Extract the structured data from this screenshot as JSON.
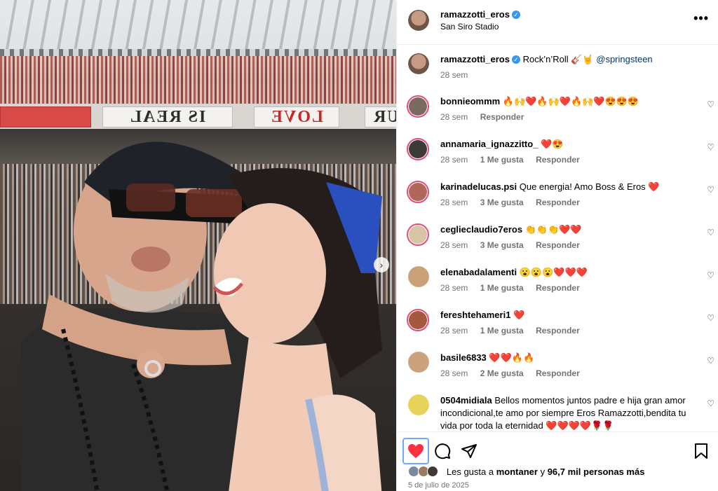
{
  "post": {
    "author": "ramazzotti_eros",
    "location": "San Siro Stadio",
    "more_icon": "more-horizontal-icon"
  },
  "photo": {
    "banner_left": "IS REAL",
    "banner_mid": "LOVE",
    "banner_right": "UR",
    "next_icon": "chevron-right-icon"
  },
  "caption": {
    "username": "ramazzotti_eros",
    "text": "Rock’n’Roll 🎸🤘",
    "mention": "@springsteen",
    "time": "28 sem"
  },
  "comments": [
    {
      "username": "bonnieommm",
      "text": "🔥🙌❤️🔥🙌❤️🔥🙌❤️😍😍😍",
      "time": "28 sem",
      "likes": "",
      "reply": "Responder",
      "avatar_color": "#7a6a60"
    },
    {
      "username": "annamaria_ignazzitto_",
      "text": "❤️😍",
      "time": "28 sem",
      "likes": "1 Me gusta",
      "reply": "Responder",
      "avatar_color": "#3d3a3a"
    },
    {
      "username": "karinadelucas.psi",
      "text": "Que energia! Amo Boss & Eros ❤️",
      "time": "28 sem",
      "likes": "3 Me gusta",
      "reply": "Responder",
      "avatar_color": "#b0675a"
    },
    {
      "username": "ceglieclaudio7eros",
      "text": "👏👏👏❤️❤️",
      "time": "28 sem",
      "likes": "3 Me gusta",
      "reply": "Responder",
      "avatar_color": "#d8c5a5"
    },
    {
      "username": "elenabadalamenti",
      "text": "😮😮😮❤️❤️❤️",
      "time": "28 sem",
      "likes": "1 Me gusta",
      "reply": "Responder",
      "avatar_color": "#c9a27a"
    },
    {
      "username": "fereshtehameri1",
      "text": "❤️",
      "time": "28 sem",
      "likes": "1 Me gusta",
      "reply": "Responder",
      "avatar_color": "#a5583e"
    },
    {
      "username": "basile6833",
      "text": "❤️❤️🔥🔥",
      "time": "28 sem",
      "likes": "2 Me gusta",
      "reply": "Responder",
      "avatar_color": "#caa27e"
    },
    {
      "username": "0504midiala",
      "text": "Bellos momentos juntos padre e hija gran amor incondicional,te amo por siempre Eros Ramazzotti,bendita tu vida por toda la eternidad ❤️❤️❤️❤️🌹🌹",
      "time": "",
      "likes": "",
      "reply": "",
      "avatar_color": "#e8d35a"
    }
  ],
  "actions": {
    "like_icon": "heart-filled-icon",
    "comment_icon": "comment-icon",
    "share_icon": "share-icon",
    "save_icon": "bookmark-icon"
  },
  "likes": {
    "prefix": "Les gusta a",
    "user": "montaner",
    "conj": "y",
    "count": "96,7 mil personas más"
  },
  "date": "5 de julio de 2025",
  "colors": {
    "like": "#ff3040",
    "link": "#00376b",
    "verified": "#3897f0",
    "meta": "#737373"
  }
}
